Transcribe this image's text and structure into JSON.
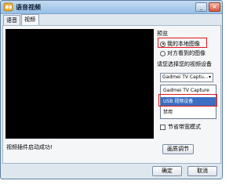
{
  "window": {
    "title": "语音视频",
    "close_glyph": "×",
    "minimize_glyph": "_"
  },
  "tabs": [
    {
      "label": "语音"
    },
    {
      "label": "视频"
    }
  ],
  "video_panel": {
    "status_text": "视频插件启动成功!"
  },
  "preview": {
    "label": "预览",
    "option_local": "我的本地图像",
    "option_remote": "对方看到的图像",
    "selected": "我的本地图像"
  },
  "device": {
    "label": "请您选择您的视频设备",
    "selected": "Gadmei TV Captu...",
    "options": [
      "Gadmei TV Capture",
      "USB 视频设备",
      "禁用"
    ],
    "highlighted": "USB 视频设备"
  },
  "checkbox": {
    "label": "节省带宽模式",
    "checked": false
  },
  "buttons": {
    "settings": "画质调节",
    "ok": "确定",
    "cancel": "取消"
  },
  "colors": {
    "highlight_box": "#e0141c",
    "selection": "#3b6fc4",
    "titlebar": "#97bfe7"
  }
}
